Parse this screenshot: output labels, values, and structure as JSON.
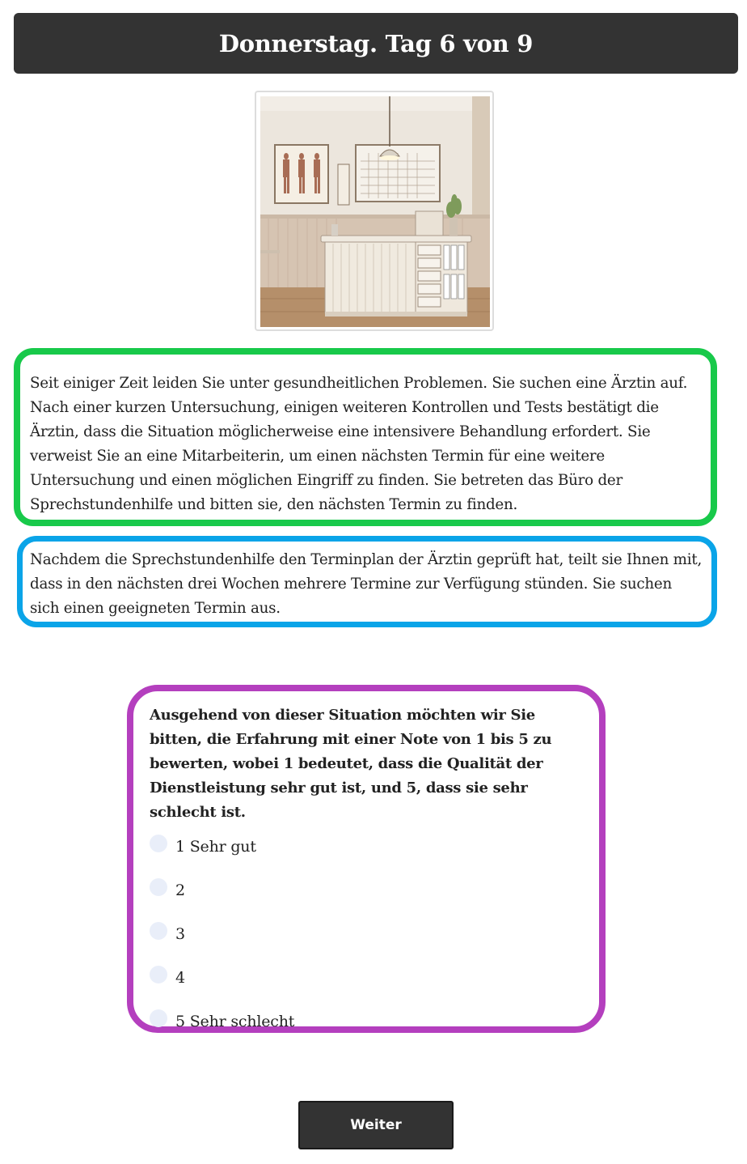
{
  "header": {
    "title": "Donnerstag. Tag 6 von 9"
  },
  "scenario": {
    "context": "Seit einiger Zeit leiden Sie unter gesundheitlichen Problemen. Sie suchen eine Ärztin auf. Nach einer kurzen Untersuchung, einigen weiteren Kontrollen und Tests bestätigt die Ärztin, dass die Situation möglicherweise eine intensivere Behandlung erfordert. Sie verweist Sie an eine Mitarbeiterin, um einen nächsten Termin für eine weitere Untersuchung und einen möglichen Eingriff zu finden. Sie betreten das Büro der Sprechstundenhilfe und bitten sie, den nächsten Termin zu finden.",
    "outcome": "Nachdem die Sprechstundenhilfe den Terminplan der Ärztin geprüft hat, teilt sie Ihnen mit, dass in den nächsten drei Wochen mehrere Termine zur Verfügung stünden. Sie suchen sich einen geeigneten Termin aus."
  },
  "rating": {
    "question": "Ausgehend von dieser Situation möchten wir Sie bitten, die Erfahrung mit einer Note von 1 bis 5 zu bewerten, wobei 1 bedeutet, dass die Qualität der Dienstleistung sehr gut ist, und 5, dass sie sehr schlecht ist.",
    "options": [
      "1 Sehr gut",
      "2",
      "3",
      "4",
      "5 Sehr schlecht"
    ],
    "selected": null
  },
  "actions": {
    "next_label": "Weiter"
  },
  "colors": {
    "header_bg": "#333333",
    "context_border": "#18c94a",
    "outcome_border": "#0aa4e8",
    "question_border": "#b43fbe",
    "radio_fill": "#e9eef9",
    "button_bg": "#333333"
  },
  "icons": {
    "scene": "doctor-reception-office-illustration"
  }
}
